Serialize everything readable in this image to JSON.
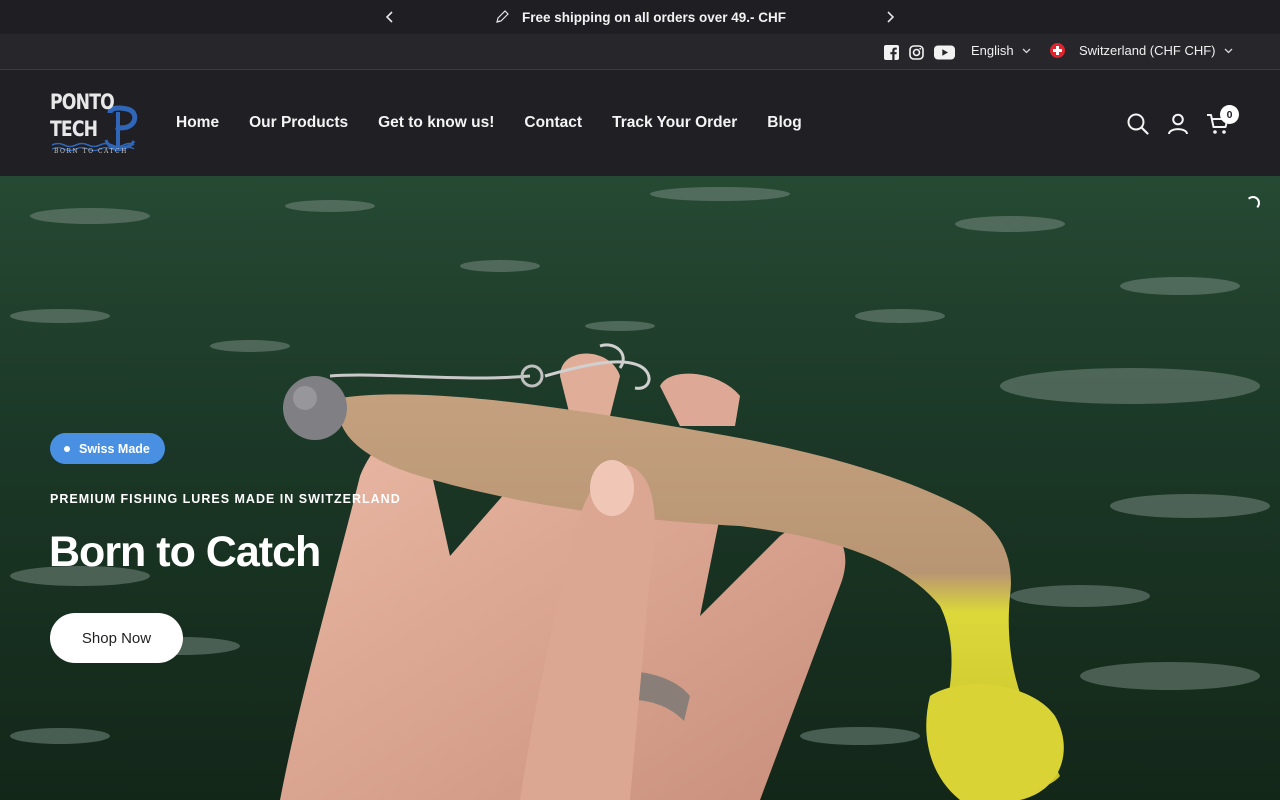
{
  "announcement": {
    "message": "Free shipping on all orders over 49.- CHF",
    "icon": "pen-icon"
  },
  "utility": {
    "social_icons": [
      "facebook-icon",
      "instagram-icon",
      "youtube-icon"
    ],
    "language": "English",
    "country": "Switzerland (CHF CHF)"
  },
  "header": {
    "logo": {
      "line1": "PONTO",
      "line2": "TECH",
      "tagline": "BORN TO CATCH"
    },
    "nav": [
      "Home",
      "Our Products",
      "Get to know us!",
      "Contact",
      "Track Your Order",
      "Blog"
    ],
    "cart_count": "0"
  },
  "hero": {
    "badge": "Swiss Made",
    "subtitle": "PREMIUM FISHING LURES MADE IN SWITZERLAND",
    "headline": "Born to Catch",
    "cta": "Shop Now"
  },
  "colors": {
    "background_dark": "#1f1f24",
    "badge_blue": "#4a90e2",
    "lure_yellow": "#e3e034",
    "lure_tan": "#c4a07e"
  }
}
